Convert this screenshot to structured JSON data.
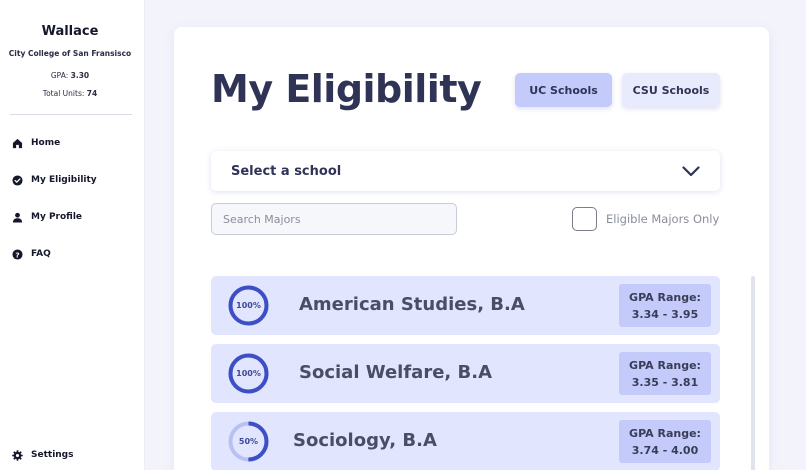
{
  "user": {
    "name": "Wallace",
    "college": "City College of San Fransisco",
    "gpa_label": "GPA:",
    "gpa": "3.30",
    "units_label": "Total Units:",
    "units": "74"
  },
  "nav": {
    "home": "Home",
    "eligibility": "My Eligibility",
    "profile": "My Profile",
    "faq": "FAQ",
    "settings": "Settings"
  },
  "page": {
    "title": "My Eligibility"
  },
  "tabs": {
    "uc": "UC Schools",
    "csu": "CSU Schools",
    "active": "uc"
  },
  "select": {
    "label": "Select a school"
  },
  "search": {
    "placeholder": "Search Majors",
    "value": ""
  },
  "filter": {
    "eligible_label": "Eligible Majors Only",
    "checked": false
  },
  "majors": [
    {
      "name": "American Studies, B.A",
      "percent": 100,
      "percent_label": "100%",
      "gpa_label": "GPA Range:",
      "gpa_range": "3.34 - 3.95"
    },
    {
      "name": "Social Welfare, B.A",
      "percent": 100,
      "percent_label": "100%",
      "gpa_label": "GPA Range:",
      "gpa_range": "3.35 - 3.81"
    },
    {
      "name": "Sociology, B.A",
      "percent": 50,
      "percent_label": "50%",
      "gpa_label": "GPA Range:",
      "gpa_range": "3.74 - 4.00"
    }
  ],
  "colors": {
    "accent": "#3d4fc4",
    "ring_track": "#b9c1f2",
    "tab_active": "#c4cbfa",
    "tab_inactive": "#e8ebfb",
    "card_bg": "#e1e5fd"
  },
  "icons": {
    "home": "home-icon",
    "eligibility": "check-circle-icon",
    "profile": "user-icon",
    "faq": "question-circle-icon",
    "settings": "gear-icon",
    "select": "chevron-down-icon"
  }
}
